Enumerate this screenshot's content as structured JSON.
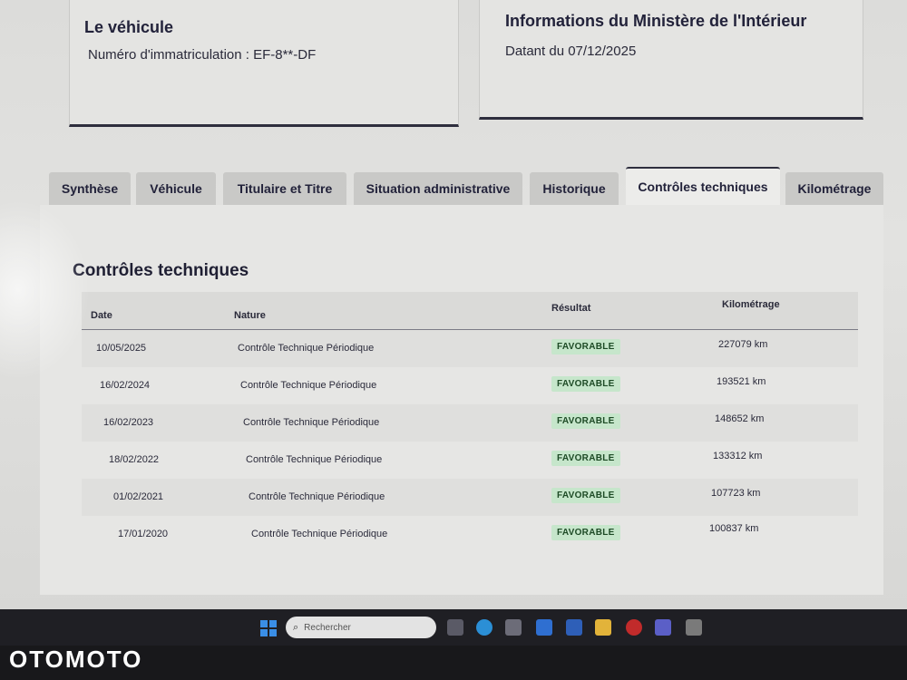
{
  "vehicle_card": {
    "title": "Le véhicule",
    "registration": "Numéro d'immatriculation : EF-8**-DF"
  },
  "ministry_card": {
    "title": "Informations du Ministère de l'Intérieur",
    "date": "Datant du 07/12/2025"
  },
  "tabs": [
    {
      "label": "Synthèse"
    },
    {
      "label": "Véhicule"
    },
    {
      "label": "Titulaire et Titre"
    },
    {
      "label": "Situation administrative"
    },
    {
      "label": "Historique"
    },
    {
      "label": "Contrôles techniques"
    },
    {
      "label": "Kilométrage"
    }
  ],
  "active_tab": "Contrôles techniques",
  "section": {
    "title": "Contrôles techniques"
  },
  "table": {
    "headers": {
      "date": "Date",
      "nature": "Nature",
      "result": "Résultat",
      "mileage": "Kilométrage"
    },
    "rows": [
      {
        "date": "10/05/2025",
        "nature": "Contrôle Technique Périodique",
        "result": "FAVORABLE",
        "mileage": "227079 km"
      },
      {
        "date": "16/02/2024",
        "nature": "Contrôle Technique Périodique",
        "result": "FAVORABLE",
        "mileage": "193521 km"
      },
      {
        "date": "16/02/2023",
        "nature": "Contrôle Technique Périodique",
        "result": "FAVORABLE",
        "mileage": "148652 km"
      },
      {
        "date": "18/02/2022",
        "nature": "Contrôle Technique Périodique",
        "result": "FAVORABLE",
        "mileage": "133312 km"
      },
      {
        "date": "01/02/2021",
        "nature": "Contrôle Technique Périodique",
        "result": "FAVORABLE",
        "mileage": "107723 km"
      },
      {
        "date": "17/01/2020",
        "nature": "Contrôle Technique Périodique",
        "result": "FAVORABLE",
        "mileage": "100837 km"
      }
    ]
  },
  "taskbar": {
    "search_placeholder": "Rechercher",
    "apps": [
      "task-view-icon",
      "edge-icon",
      "store-icon",
      "mail-icon",
      "app-l-icon",
      "folder-icon",
      "opera-icon",
      "teams-icon",
      "misc-app-icon"
    ]
  },
  "watermark": "OTOMOTO",
  "colors": {
    "badge_bg": "#c6e6cb",
    "badge_text": "#1d4a25",
    "accent_dark": "#2e2e3e"
  }
}
